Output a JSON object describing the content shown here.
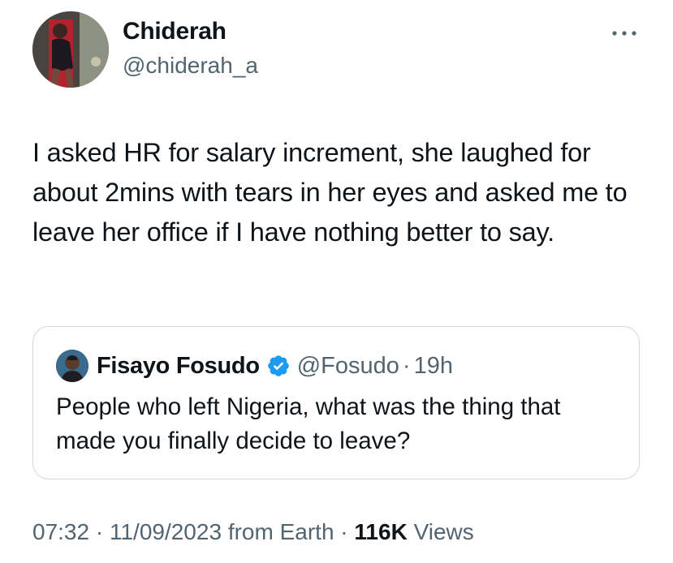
{
  "author": {
    "name": "Chiderah",
    "handle": "@chiderah_a"
  },
  "tweet": {
    "text": "I asked HR for salary increment, she laughed for about 2mins with tears in her eyes and asked me to leave her office if I have nothing better to say."
  },
  "quoted": {
    "name": "Fisayo Fosudo",
    "handle": "@Fosudo",
    "separator": "·",
    "time": "19h",
    "text": "People who left Nigeria, what was the thing that made you finally decide to leave?",
    "verified_icon": "verified-badge-icon",
    "verified_color": "#1d9bf0"
  },
  "meta": {
    "time": "07:32",
    "separator_1": "·",
    "date": "11/09/2023",
    "location": "from Earth",
    "separator_2": "·",
    "views_count": "116K",
    "views_label": "Views"
  },
  "icons": {
    "more": "more-options-icon"
  },
  "colors": {
    "text_primary": "#0f1419",
    "text_secondary": "#536471",
    "border": "#cfd9de",
    "accent": "#1d9bf0"
  }
}
